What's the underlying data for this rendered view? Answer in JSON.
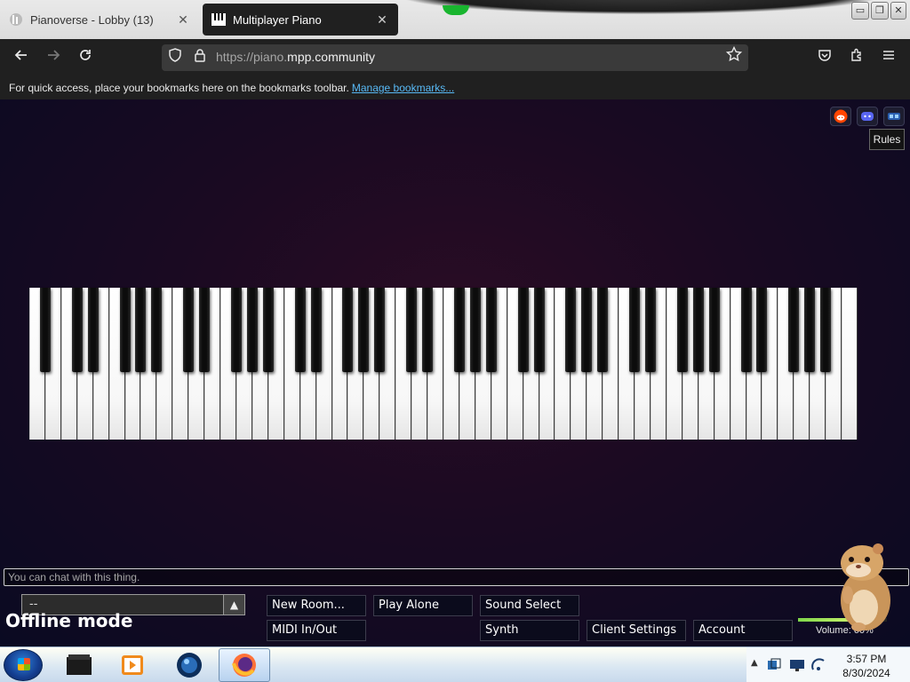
{
  "browser": {
    "tabs": [
      {
        "label": "Pianoverse - Lobby (13)",
        "close": "✕",
        "active": false
      },
      {
        "label": "Multiplayer Piano",
        "close": "✕",
        "active": true
      }
    ],
    "window_buttons": {
      "minimize": "▭",
      "restore": "❐",
      "close": "✕"
    },
    "url_prefix": "https://piano.",
    "url_domain": "mpp.community",
    "bookmarks_message": "For quick access, place your bookmarks here on the bookmarks toolbar.",
    "manage_bookmarks": "Manage bookmarks..."
  },
  "page": {
    "rules_tooltip": "Rules",
    "corner_icons": [
      "reddit-icon",
      "discord-icon",
      "gamepad-icon"
    ],
    "chat_placeholder": "You can chat with this thing.",
    "room_select_value": "--",
    "offline_text": "Offline mode",
    "buttons": {
      "new_room": "New Room...",
      "play_alone": "Play Alone",
      "sound_select": "Sound Select",
      "midi": "MIDI In/Out",
      "synth": "Synth",
      "client_settings": "Client Settings",
      "account": "Account"
    },
    "volume_label": "Volume: 60%",
    "volume_level": 0.6,
    "piano": {
      "white_keys": 52,
      "black_pattern_start": "A0"
    }
  },
  "taskbar": {
    "items": [
      "file-manager-icon",
      "media-player-icon",
      "browser-globe-icon",
      "firefox-icon"
    ],
    "tray_icons": [
      "network-icon",
      "display-icon",
      "wifi-icon"
    ],
    "time": "3:57 PM",
    "date": "8/30/2024"
  },
  "colors": {
    "accent_link": "#58b9f5",
    "page_bg": "#1a0a22",
    "green_logo": "#19b52f"
  }
}
